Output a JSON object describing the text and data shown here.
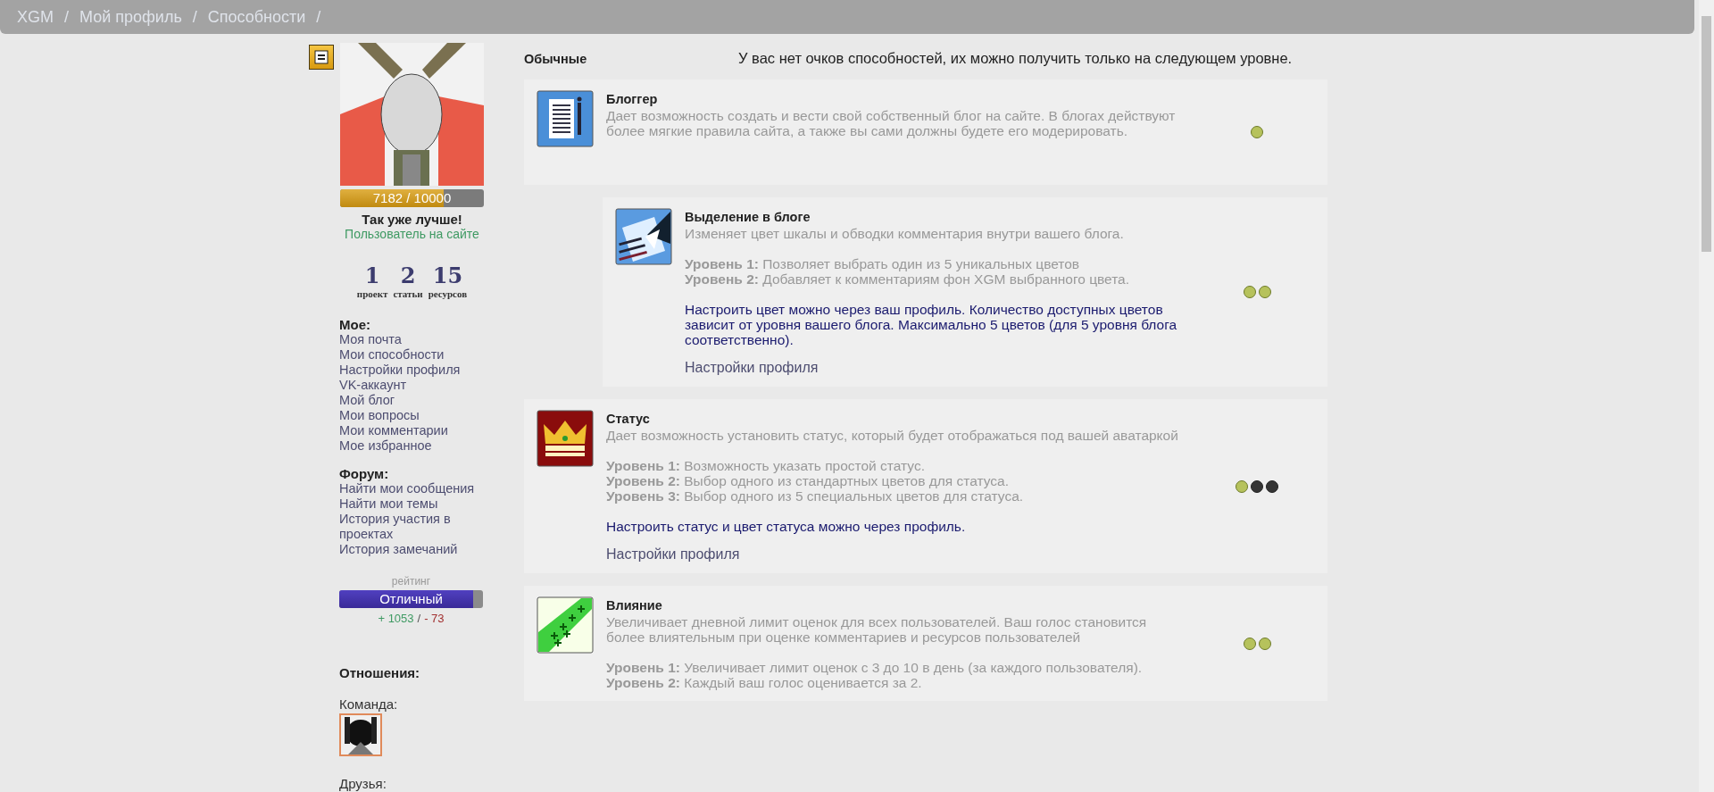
{
  "breadcrumbs": [
    {
      "label": "XGM",
      "separator": "/"
    },
    {
      "label": "Мой профиль",
      "separator": "/"
    },
    {
      "label": "Способности",
      "separator": "/"
    }
  ],
  "profile": {
    "xp": {
      "text": "7182 / 10000",
      "level": 0.7182
    },
    "status": "Так уже лучше!",
    "online": "Пользователь на сайте",
    "stats": [
      {
        "value": "1",
        "label": "проект"
      },
      {
        "value": "2",
        "label": "статьи"
      },
      {
        "value": "15",
        "label": "ресурсов"
      }
    ]
  },
  "menus": [
    {
      "title": "Мое:",
      "items": [
        "Моя почта",
        "Мои способности",
        "Настройки профиля",
        "VK-аккаунт",
        "Мой блог",
        "Мои вопросы",
        "Мои комментарии",
        "Мое избранное"
      ]
    },
    {
      "title": "Форум:",
      "items": [
        "Найти мои сообщения",
        "Найти мои темы",
        "История участия в проектах",
        "История замечаний"
      ]
    }
  ],
  "rating": {
    "caption": "рейтинг",
    "label": "Отличный",
    "level": 0.93,
    "plus": "+ 1053",
    "separator": "/",
    "minus": "- 73"
  },
  "relations": {
    "title": "Отношения:",
    "team_label": "Команда:",
    "friends_label": "Друзья:"
  },
  "section_title": "Обычные",
  "notice": "У вас нет очков способностей, их можно получить только на следующем уровне.",
  "abilities": [
    {
      "kind": "blog",
      "nested": false,
      "title": "Блоггер",
      "description": "Дает возможность создать и вести свой собственный блог на сайте. В блогах действуют более мягкие правила сайта, а также вы сами должны будете его модерировать.",
      "levels": [
        {
          "acquired": true
        }
      ]
    },
    {
      "kind": "highlight",
      "nested": true,
      "title": "Выделение в блоге",
      "description": "Изменяет цвет шкалы и обводки комментария внутри вашего блога.",
      "level_lines": [
        "**Уровень 1:** Позволяет выбрать один из 5 уникальных цветов",
        "**Уровень 2:** Добавляет к комментариям фон XGM выбранного цвета."
      ],
      "note": "Настроить цвет можно через ваш профиль. Количество доступных цветов зависит от уровня вашего блога. Максимально 5 цветов (для 5 уровня блога соответственно).",
      "link": "Настройки профиля",
      "levels": [
        {
          "acquired": true
        },
        {
          "acquired": true
        }
      ]
    },
    {
      "kind": "crown",
      "nested": false,
      "title": "Статус",
      "description": "Дает возможность установить статус, который будет отображаться под вашей аватаркой",
      "level_lines": [
        "**Уровень 1:** Возможность указать простой статус.",
        "**Уровень 2:** Выбор одного из стандартных цветов для статуса.",
        "**Уровень 3:** Выбор одного из 5 специальных цветов для статуса."
      ],
      "note": "Настроить статус и цвет статуса можно через профиль.",
      "link": "Настройки профиля",
      "levels": [
        {
          "acquired": true
        },
        {
          "acquired": false
        },
        {
          "acquired": false
        }
      ]
    },
    {
      "kind": "plus",
      "nested": false,
      "title": "Влияние",
      "description": "Увеличивает дневной лимит оценок для всех пользователей. Ваш голос становится более влиятельным при оценке комментариев и ресурсов пользователей",
      "level_lines": [
        "**Уровень 1:** Увеличивает лимит оценок с 3 до 10 в день (за каждого пользователя).",
        "**Уровень 2:** Каждый ваш голос оценивается за 2."
      ],
      "levels": [
        {
          "acquired": true
        },
        {
          "acquired": true
        }
      ]
    }
  ]
}
